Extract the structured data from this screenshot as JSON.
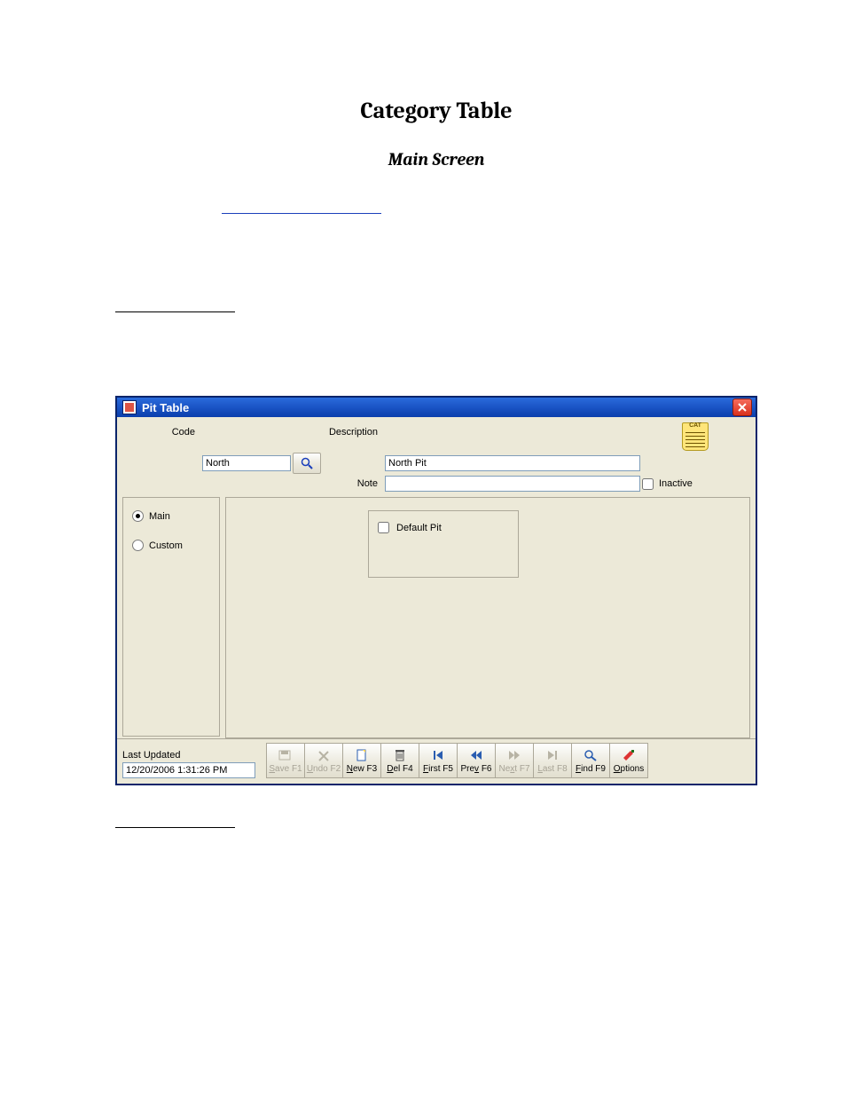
{
  "doc": {
    "title": "Category Table",
    "subtitle": "Main Screen"
  },
  "window": {
    "title": "Pit Table",
    "fields": {
      "code_label": "Code",
      "code_value": "North",
      "description_label": "Description",
      "description_value": "North Pit",
      "note_label": "Note",
      "note_value": "",
      "inactive_label": "Inactive",
      "inactive_checked": false
    },
    "cat_icon_name": "cat-notepad-icon",
    "tabs": {
      "main_label": "Main",
      "custom_label": "Custom",
      "selected": "main"
    },
    "default_group": {
      "label": "Default Pit",
      "checked": false
    },
    "last_updated": {
      "label": "Last Updated",
      "value": "12/20/2006 1:31:26 PM"
    },
    "toolbar": [
      {
        "id": "save",
        "label": "Save F1",
        "accel": "S",
        "enabled": false,
        "icon": "save-icon"
      },
      {
        "id": "undo",
        "label": "Undo F2",
        "accel": "U",
        "enabled": false,
        "icon": "undo-icon"
      },
      {
        "id": "new",
        "label": "New F3",
        "accel": "N",
        "enabled": true,
        "icon": "new-icon"
      },
      {
        "id": "del",
        "label": "Del F4",
        "accel": "D",
        "enabled": true,
        "icon": "delete-icon"
      },
      {
        "id": "first",
        "label": "First F5",
        "accel": "F",
        "enabled": true,
        "icon": "first-icon"
      },
      {
        "id": "prev",
        "label": "Prev F6",
        "accel": "v",
        "enabled": true,
        "icon": "prev-icon"
      },
      {
        "id": "next",
        "label": "Next F7",
        "accel": "x",
        "enabled": false,
        "icon": "next-icon"
      },
      {
        "id": "last",
        "label": "Last F8",
        "accel": "L",
        "enabled": false,
        "icon": "last-icon"
      },
      {
        "id": "find",
        "label": "Find F9",
        "accel": "F",
        "enabled": true,
        "icon": "find-icon"
      },
      {
        "id": "options",
        "label": "Options",
        "accel": "O",
        "enabled": true,
        "icon": "options-icon"
      }
    ]
  }
}
